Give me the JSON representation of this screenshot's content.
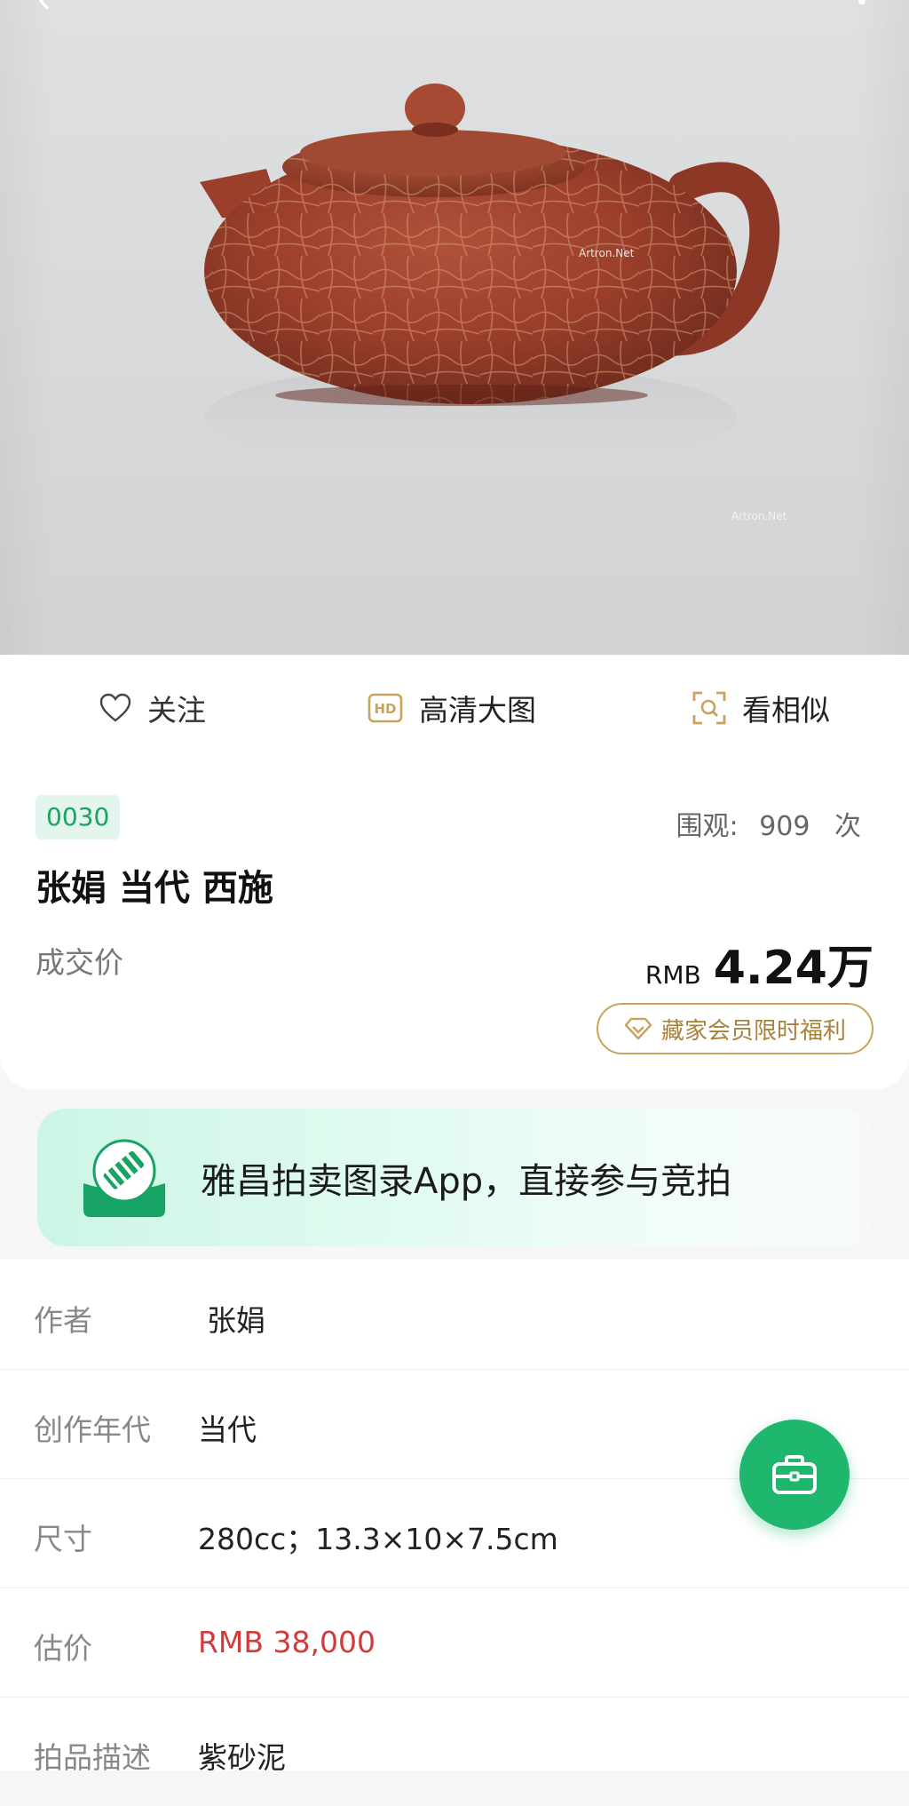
{
  "hero": {
    "watermark_1": "Artron.Net",
    "watermark_2": "Artron.Net"
  },
  "actions": {
    "follow_label": "关注",
    "hd_label": "高清大图",
    "similar_label": "看相似"
  },
  "lot": {
    "number": "0030",
    "views_label": "围观:",
    "views_count": "909",
    "views_unit": "次",
    "title": "张娟 当代 西施",
    "price_label": "成交价",
    "price_currency": "RMB",
    "price_amount": "4.24万",
    "member_button": "藏家会员限时福利"
  },
  "banner": {
    "text": "雅昌拍卖图录App，直接参与竞拍"
  },
  "details": [
    {
      "key": "作者",
      "value": "张娟"
    },
    {
      "key": "创作年代",
      "value": "当代"
    },
    {
      "key": "尺寸",
      "value": "280cc；13.3×10×7.5cm"
    },
    {
      "key": "估价",
      "value": "RMB  38,000"
    },
    {
      "key": "拍品描述",
      "value": "紫砂泥"
    }
  ],
  "colors": {
    "accent_green": "#1fb66e",
    "badge_green": "#19a463",
    "gold": "#c9a35d",
    "price_red": "#d33b3b",
    "teapot_clay": "#9c3f2c"
  },
  "icons": {
    "follow": "heart-outline-icon",
    "hd": "hd-icon",
    "similar": "scan-search-icon",
    "member": "diamond-icon",
    "fab": "briefcase-icon",
    "banner_logo": "artron-gavel-logo"
  }
}
